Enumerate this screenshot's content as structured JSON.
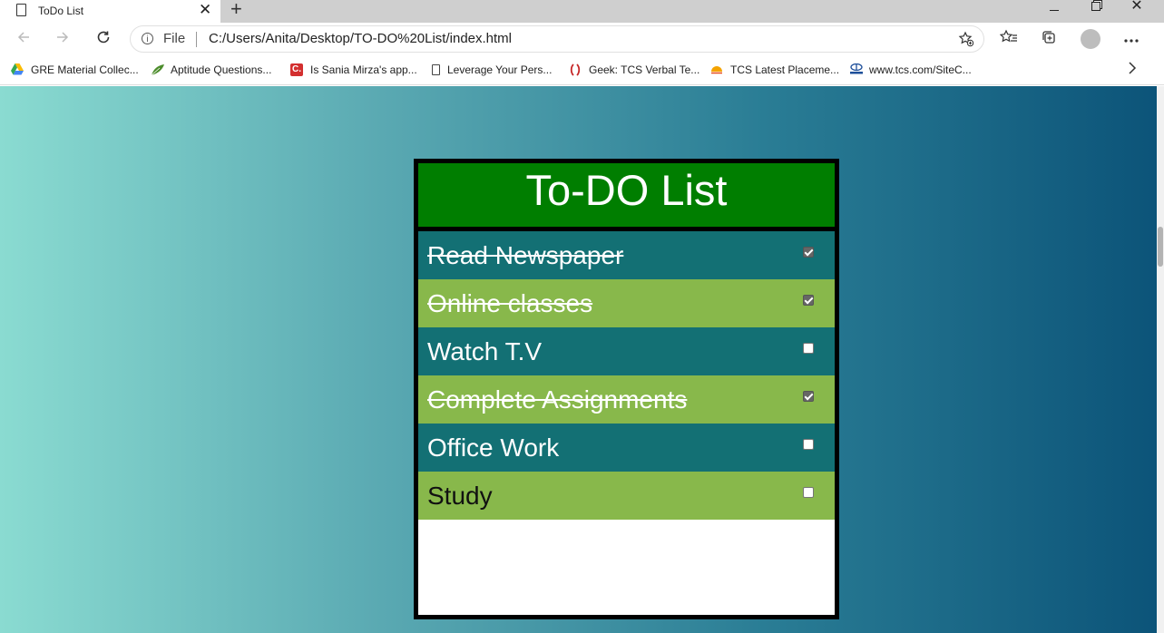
{
  "tab": {
    "title": "ToDo List",
    "close": "✕",
    "new_tab": "+"
  },
  "window": {
    "close": "✕"
  },
  "address": {
    "scheme": "File",
    "url": "C:/Users/Anita/Desktop/TO-DO%20List/index.html"
  },
  "bookmarks": [
    {
      "label": "GRE Material Collec...",
      "icon": "google-drive-icon",
      "color": "#34a853"
    },
    {
      "label": "Aptitude Questions...",
      "icon": "leaf-icon",
      "color": "#4c8c2b"
    },
    {
      "label": "Is Sania Mirza's app...",
      "icon": "c-logo-icon",
      "color": "#d32f2f"
    },
    {
      "label": "Leverage Your Pers...",
      "icon": "page-icon",
      "color": "#444444"
    },
    {
      "label": "Geek: TCS Verbal Te...",
      "icon": "bracket-logo-icon",
      "color": "#c62828"
    },
    {
      "label": "TCS Latest Placeme...",
      "icon": "sun-logo-icon",
      "color": "#f4a300"
    },
    {
      "label": "www.tcs.com/SiteC...",
      "icon": "tata-logo-icon",
      "color": "#1e4f9a"
    }
  ],
  "todo": {
    "title": "To-DO List",
    "items": [
      {
        "text": "Read Newspaper",
        "done": true,
        "style": "dark"
      },
      {
        "text": "Online classes",
        "done": true,
        "style": "light"
      },
      {
        "text": "Watch T.V",
        "done": false,
        "style": "dark"
      },
      {
        "text": "Complete Assignments",
        "done": true,
        "style": "light"
      },
      {
        "text": "Office Work",
        "done": false,
        "style": "dark"
      },
      {
        "text": "Study",
        "done": false,
        "style": "light-plain"
      }
    ]
  },
  "colors": {
    "header_green": "#007e00",
    "row_dark": "#137074",
    "row_light": "#88b84b",
    "gradient_start": "#8adbd1",
    "gradient_end": "#0c5479"
  }
}
